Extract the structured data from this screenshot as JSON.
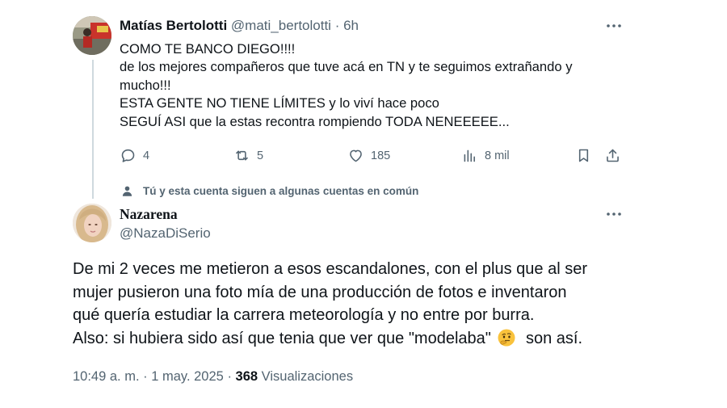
{
  "reply": {
    "author_name": "Matías Bertolotti",
    "author_handle": "@mati_bertolotti",
    "separator": "·",
    "time": "6h",
    "lines": [
      "COMO TE BANCO DIEGO!!!!",
      "de los mejores compañeros que tuve acá en TN y te seguimos extrañando y",
      "mucho!!!",
      "ESTA GENTE NO TIENE LÍMITES y lo viví hace poco",
      "SEGUÍ ASI que la estas recontra rompiendo TODA NENEEEEE..."
    ],
    "actions": {
      "replies": "4",
      "reposts": "5",
      "likes": "185",
      "views": "8 mil"
    },
    "icons": [
      "more-icon",
      "reply-icon",
      "repost-icon",
      "like-icon",
      "views-icon",
      "bookmark-icon",
      "share-icon"
    ]
  },
  "social_context": {
    "text": "Tú y esta cuenta siguen a algunas cuentas en común",
    "icon": "person-icon"
  },
  "main_post": {
    "author_name": "Nazarena",
    "author_handle": "@NazaDiSerio",
    "lines": [
      "De mi 2 veces me metieron a esos escandalones, con el plus que al ser",
      "mujer pusieron una foto mía de una producción de fotos e inventaron",
      "qué quería estudiar la carrera meteorología y no entre por burra."
    ],
    "last_line_before_emoji": "Also: si hubiera sido así que tenia que ver que \"modelaba\"",
    "last_line_after_emoji": "son así.",
    "emoji": "thinking-face-emoji",
    "time": "10:49 a. m.",
    "date_separator": "·",
    "date": "1 may. 2025",
    "views_separator": "·",
    "views_count": "368",
    "views_label": "Visualizaciones"
  },
  "colors": {
    "text": "#0f1419",
    "secondary": "#536471",
    "thread_line": "#cfd9de"
  }
}
